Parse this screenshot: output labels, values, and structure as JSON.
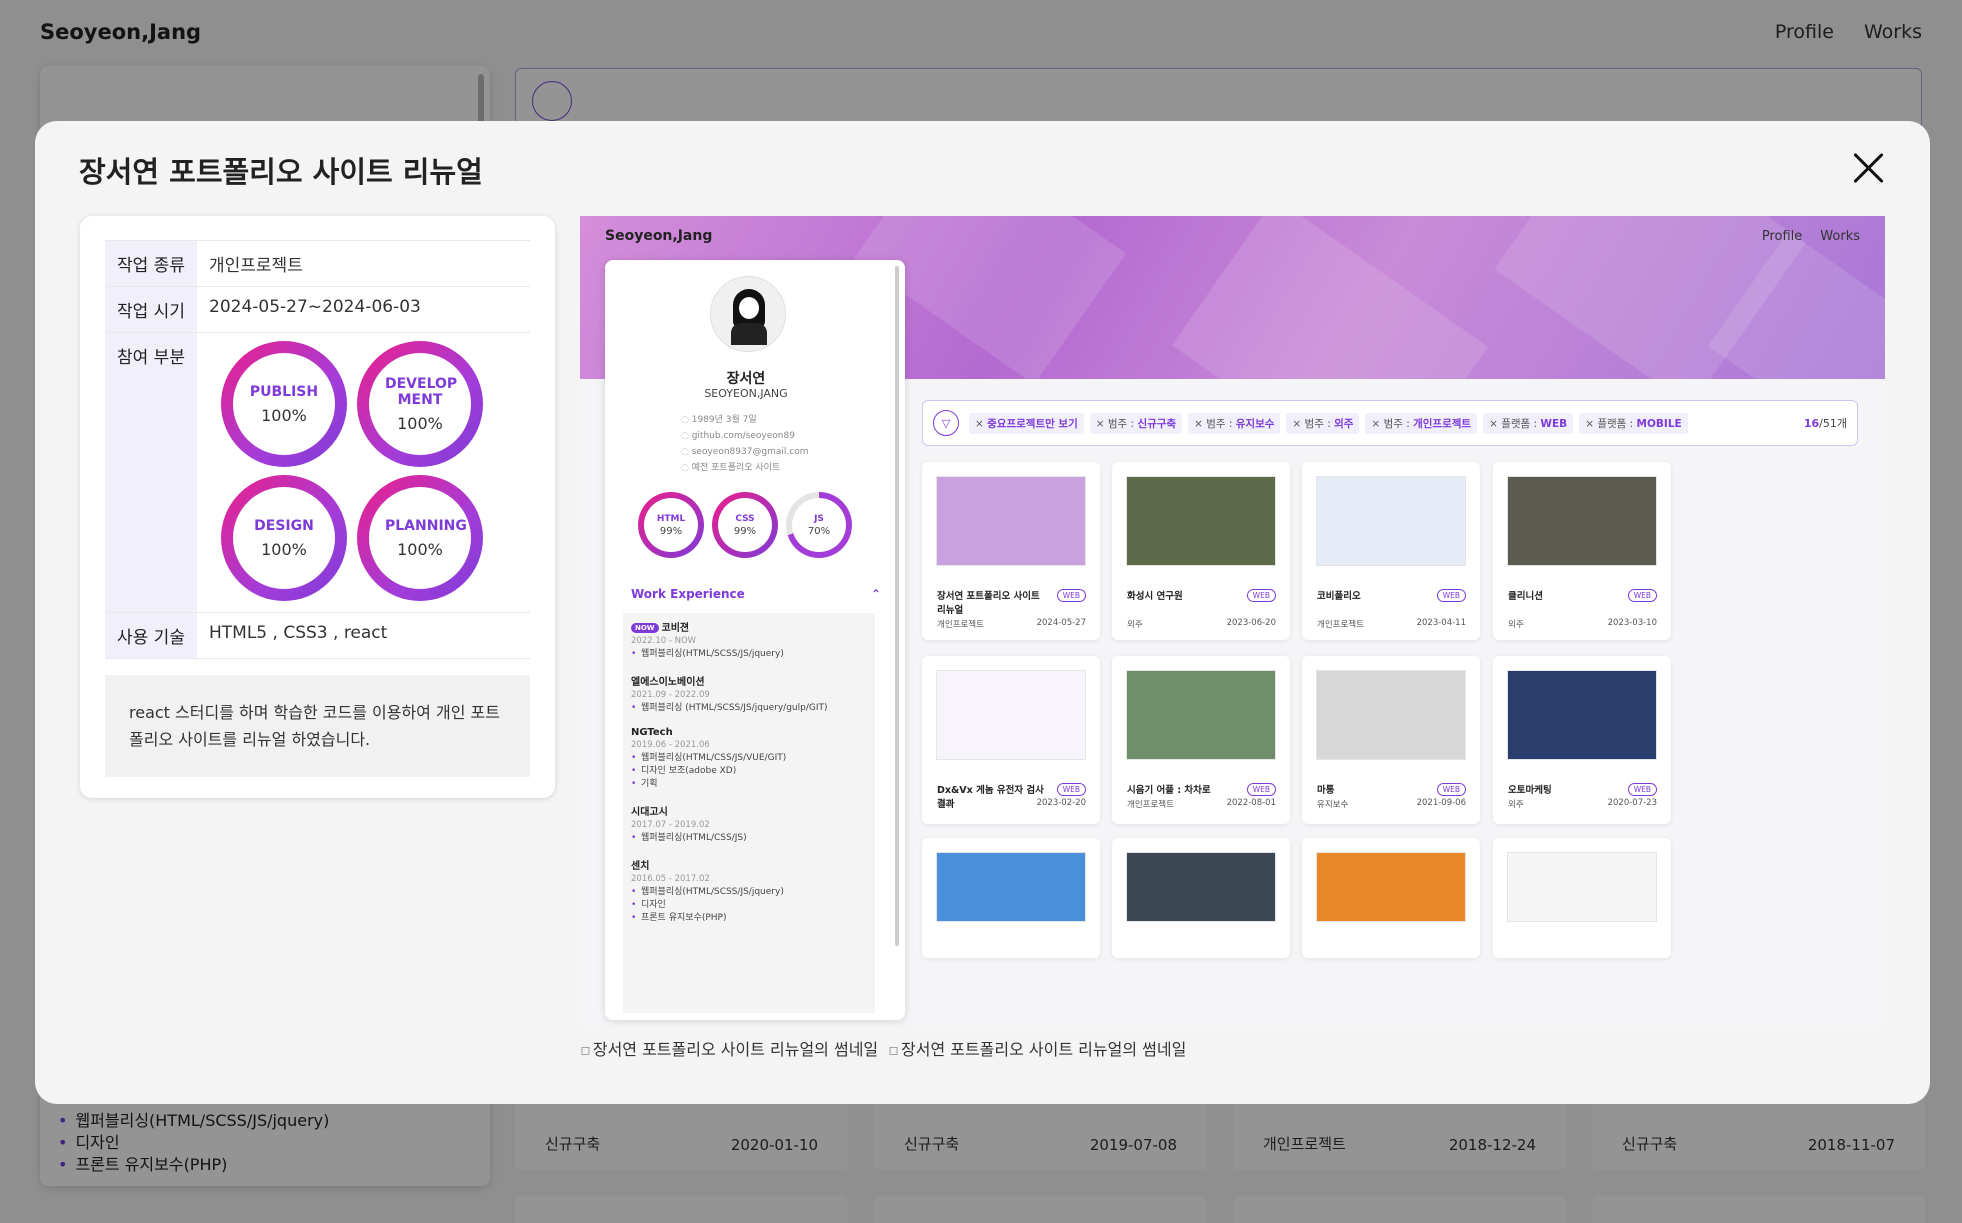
{
  "background": {
    "logo": "Seoyeon,Jang",
    "nav": [
      "Profile",
      "Works"
    ],
    "profile_list": [
      "웹퍼블리싱(HTML/SCSS/JS/jquery)",
      "디자인",
      "프론트 유지보수(PHP)"
    ],
    "cards": [
      {
        "category": "신규구축",
        "date": "2020-01-10"
      },
      {
        "category": "신규구축",
        "date": "2019-07-08"
      },
      {
        "category": "개인프로젝트",
        "date": "2018-12-24"
      },
      {
        "category": "신규구축",
        "date": "2018-11-07"
      }
    ]
  },
  "modal": {
    "title": "장서연 포트폴리오 사이트 리뉴얼",
    "info": {
      "type_label": "작업 종류",
      "type_value": "개인프로젝트",
      "period_label": "작업 시기",
      "period_value": "2024-05-27~2024-06-03",
      "part_label": "참여 부분",
      "parts": [
        {
          "name": "PUBLISH",
          "pct": "100%"
        },
        {
          "name": "DEVELOP MENT",
          "pct": "100%"
        },
        {
          "name": "DESIGN",
          "pct": "100%"
        },
        {
          "name": "PLANNING",
          "pct": "100%"
        }
      ],
      "tech_label": "사용 기술",
      "tech_value": "HTML5 , CSS3 , react",
      "description": "react 스터디를 하며 학습한 코드를 이용하여 개인 포트폴리오 사이트를 리뉴얼 하였습니다."
    },
    "preview": {
      "logo": "Seoyeon,Jang",
      "nav": [
        "Profile",
        "Works"
      ],
      "profile": {
        "name": "장서연",
        "name_en": "SEOYEON,JANG",
        "contacts": [
          "1989년 3월 7일",
          "github.com/seoyeon89",
          "seoyeon8937@gmail.com",
          "예전 포트폴리오 사이트"
        ],
        "skills": [
          {
            "name": "HTML",
            "pct": "99%"
          },
          {
            "name": "CSS",
            "pct": "99%"
          },
          {
            "name": "JS",
            "pct": "70%"
          }
        ],
        "experience_title": "Work Experience",
        "jobs": [
          {
            "badge": "NOW",
            "company": "코비젼",
            "period": "2022.10 - NOW",
            "tasks": [
              "웹퍼블리싱(HTML/SCSS/JS/jquery)"
            ]
          },
          {
            "badge": "",
            "company": "엘에스이노베이션",
            "period": "2021.09 - 2022.09",
            "tasks": [
              "웹퍼블리싱 (HTML/SCSS/JS/jquery/gulp/GIT)"
            ]
          },
          {
            "badge": "",
            "company": "NGTech",
            "period": "2019.06 - 2021.06",
            "tasks": [
              "웹퍼블리싱(HTML/CSS/JS/VUE/GIT)",
              "디자인 보조(adobe XD)",
              "기획"
            ]
          },
          {
            "badge": "",
            "company": "시대고시",
            "period": "2017.07 - 2019.02",
            "tasks": [
              "웹퍼블리싱(HTML/CSS/JS)"
            ]
          },
          {
            "badge": "",
            "company": "센치",
            "period": "2016.05 - 2017.02",
            "tasks": [
              "웹퍼블리싱(HTML/SCSS/JS/jquery)",
              "디자인",
              "프론트 유지보수(PHP)"
            ]
          }
        ]
      },
      "filters": [
        {
          "key": "",
          "value": "중요프로젝트만 보기"
        },
        {
          "key": "범주 : ",
          "value": "신규구축"
        },
        {
          "key": "범주 : ",
          "value": "유지보수"
        },
        {
          "key": "범주 : ",
          "value": "외주"
        },
        {
          "key": "범주 : ",
          "value": "개인프로젝트"
        },
        {
          "key": "플랫폼 : ",
          "value": "WEB"
        },
        {
          "key": "플랫폼 : ",
          "value": "MOBILE"
        }
      ],
      "count_current": "16",
      "count_total": "/51개",
      "cards": [
        {
          "title": "장서연 포트폴리오 사이트 리뉴얼",
          "tag": "WEB",
          "category": "개인프로젝트",
          "date": "2024-05-27",
          "thumb": "#c9a0e0"
        },
        {
          "title": "화성시 연구원",
          "tag": "WEB",
          "category": "외주",
          "date": "2023-06-20",
          "thumb": "#5d6b4a"
        },
        {
          "title": "코비폴리오",
          "tag": "WEB",
          "category": "개인프로젝트",
          "date": "2023-04-11",
          "thumb": "#e6ecf7"
        },
        {
          "title": "클리니션",
          "tag": "WEB",
          "category": "외주",
          "date": "2023-03-10",
          "thumb": "#5b5b52"
        },
        {
          "title": "Dx&Vx 게놈 유전자 검사 결과",
          "tag": "WEB",
          "category": "외주",
          "date": "2023-02-20",
          "thumb": "#f7f4fb"
        },
        {
          "title": "시음기 어플 : 차차로",
          "tag": "WEB",
          "category": "개인프로젝트",
          "date": "2022-08-01",
          "thumb": "#6e8f6a"
        },
        {
          "title": "마통",
          "tag": "WEB",
          "category": "유지보수",
          "date": "2021-09-06",
          "thumb": "#d8d8d8"
        },
        {
          "title": "오토마케팅",
          "tag": "WEB",
          "category": "외주",
          "date": "2020-07-23",
          "thumb": "#2a3e6e"
        },
        {
          "title": "",
          "tag": "",
          "category": "",
          "date": "",
          "thumb": "#4a8fd9"
        },
        {
          "title": "",
          "tag": "",
          "category": "",
          "date": "",
          "thumb": "#3b4752"
        },
        {
          "title": "",
          "tag": "",
          "category": "",
          "date": "",
          "thumb": "#e8882a"
        },
        {
          "title": "",
          "tag": "",
          "category": "",
          "date": "",
          "thumb": "#f5f5f5"
        }
      ]
    },
    "broken_images": [
      "장서연 포트폴리오 사이트 리뉴얼의 썸네일",
      "장서연 포트폴리오 사이트 리뉴얼의 썸네일"
    ],
    "close_icon": "close-icon"
  }
}
